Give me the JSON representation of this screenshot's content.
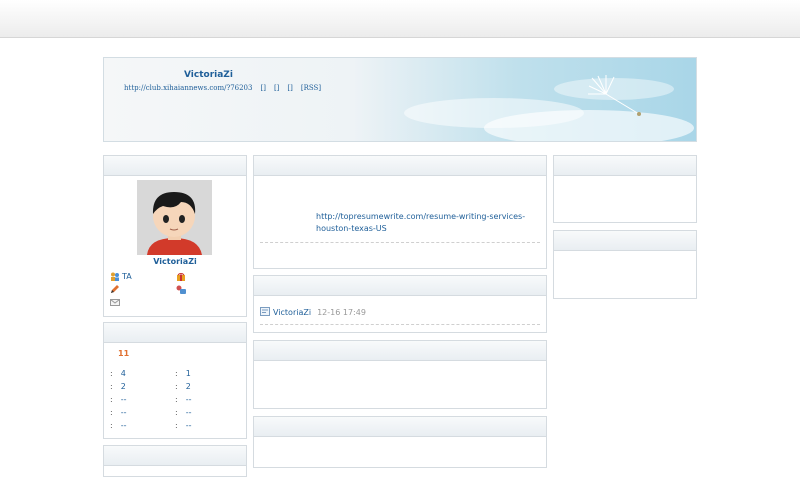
{
  "blog": {
    "owner": "VictoriaZi",
    "url": "http://club.xihaiannews.com/?76203",
    "header_links": [
      "[]",
      "[]",
      "[]",
      "[RSS]"
    ]
  },
  "profile": {
    "name": "VictoriaZi",
    "actions": [
      "TA",
      "",
      "",
      "",
      ""
    ]
  },
  "stats": {
    "highlight": "11",
    "left": [
      {
        "sep": ":",
        "value": "4"
      },
      {
        "sep": ":",
        "value": "2"
      },
      {
        "sep": ":",
        "value": "--"
      },
      {
        "sep": ":",
        "value": "--"
      },
      {
        "sep": ":",
        "value": "--"
      }
    ],
    "right": [
      {
        "sep": ":",
        "value": "1"
      },
      {
        "sep": ":",
        "value": "2"
      },
      {
        "sep": ":",
        "value": "--"
      },
      {
        "sep": ":",
        "value": "--"
      },
      {
        "sep": ":",
        "value": "--"
      }
    ]
  },
  "entry": {
    "link_line1": "http://topresumewrite.com/resume-writing-services-",
    "link_line2": "houston-texas-US"
  },
  "comment": {
    "author": "VictoriaZi",
    "time": "12-16 17:49"
  },
  "icons": {
    "friends": "users-icon",
    "gift": "gift-icon",
    "pencil": "pencil-icon",
    "chat": "chat-icon",
    "mail": "mail-icon",
    "comment": "comment-icon"
  }
}
